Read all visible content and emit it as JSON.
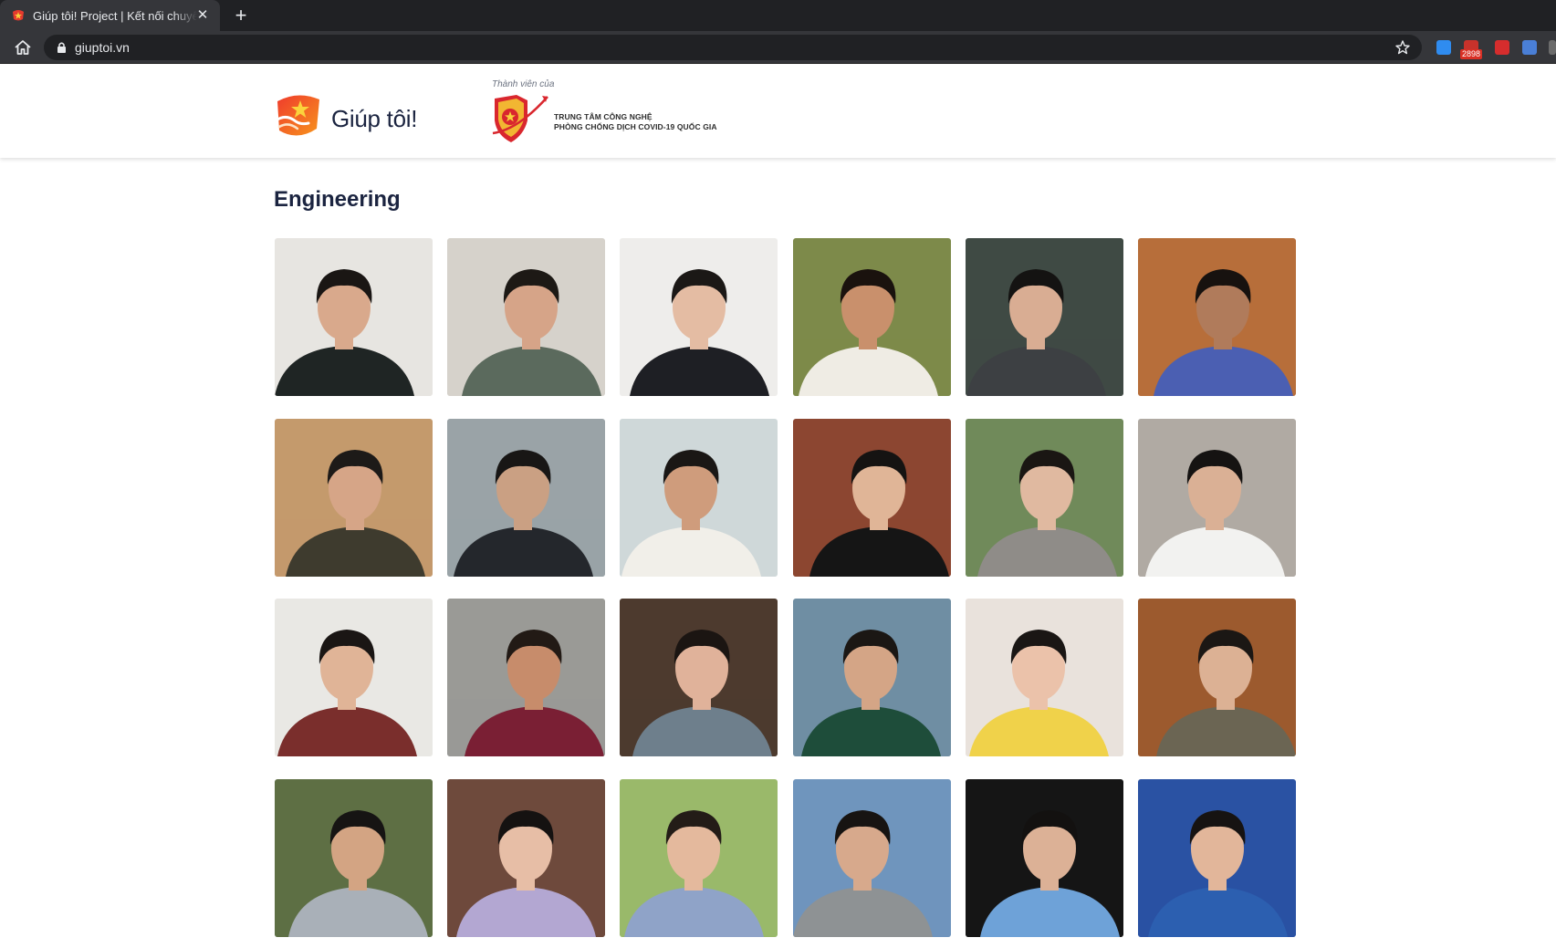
{
  "browser": {
    "tab_title": "Giúp tôi! Project | Kết nối chuyên gia",
    "url": "giuptoi.vn",
    "extension_badge": "2898"
  },
  "header": {
    "logo_text": "Giúp tôi!",
    "member_label": "Thành viên của",
    "partner_line1": "TRUNG TÂM CÔNG NGHỆ",
    "partner_line2": "PHÒNG CHỐNG DỊCH COVID-19 QUỐC GIA"
  },
  "section": {
    "title": "Engineering"
  },
  "team": [
    {
      "bg": "#e7e5e1",
      "shirt": "#1f2524",
      "skin": "#d9a98c",
      "hair": "#1a1614"
    },
    {
      "bg": "#d6d2cb",
      "shirt": "#5b6a5d",
      "skin": "#d6a488",
      "hair": "#1d1915"
    },
    {
      "bg": "#eeedeb",
      "shirt": "#1e1f24",
      "skin": "#e4bca3",
      "hair": "#1b1816"
    },
    {
      "bg": "#7d8a4a",
      "shirt": "#efece4",
      "skin": "#c9906c",
      "hair": "#1a120e"
    },
    {
      "bg": "#3f4a44",
      "shirt": "#3d4043",
      "skin": "#d9ad93",
      "hair": "#141312"
    },
    {
      "bg": "#b76e3a",
      "shirt": "#4b5fb2",
      "skin": "#b07b5b",
      "hair": "#17120f"
    },
    {
      "bg": "#c49a6c",
      "shirt": "#3e3b2e",
      "skin": "#d6a587",
      "hair": "#1d1a18"
    },
    {
      "bg": "#9aa3a7",
      "shirt": "#24272c",
      "skin": "#caa083",
      "hair": "#181615"
    },
    {
      "bg": "#cfd8d9",
      "shirt": "#f1efe9",
      "skin": "#cf9c7c",
      "hair": "#1a1715"
    },
    {
      "bg": "#8c4631",
      "shirt": "#151515",
      "skin": "#e0b597",
      "hair": "#151312"
    },
    {
      "bg": "#708a5a",
      "shirt": "#8f8c88",
      "skin": "#e0b9a0",
      "hair": "#1a1613"
    },
    {
      "bg": "#b0aaa3",
      "shirt": "#f2f2f0",
      "skin": "#dab095",
      "hair": "#151312"
    },
    {
      "bg": "#e9e8e4",
      "shirt": "#7a2e2c",
      "skin": "#e0b497",
      "hair": "#1a1614"
    },
    {
      "bg": "#9a9a96",
      "shirt": "#7a1f34",
      "skin": "#c78c6b",
      "hair": "#221a15"
    },
    {
      "bg": "#4d3a2e",
      "shirt": "#6e7f8c",
      "skin": "#e0b29a",
      "hair": "#1b1512"
    },
    {
      "bg": "#6f8ea3",
      "shirt": "#1e4d3a",
      "skin": "#d4a586",
      "hair": "#1b1714"
    },
    {
      "bg": "#e9e2dc",
      "shirt": "#f0d24a",
      "skin": "#ebc2aa",
      "hair": "#1a1614"
    },
    {
      "bg": "#9c5a2e",
      "shirt": "#6b6553",
      "skin": "#dcb194",
      "hair": "#1b1714"
    },
    {
      "bg": "#5e6f44",
      "shirt": "#a9b0b8",
      "skin": "#d3a483",
      "hair": "#161413"
    },
    {
      "bg": "#6e4a3c",
      "shirt": "#b3a7d2",
      "skin": "#e7bea6",
      "hair": "#151211"
    },
    {
      "bg": "#9ab96a",
      "shirt": "#8fa3c8",
      "skin": "#e4b99d",
      "hair": "#231c17"
    },
    {
      "bg": "#6f95bd",
      "shirt": "#8e9294",
      "skin": "#d7a98c",
      "hair": "#171412"
    },
    {
      "bg": "#151515",
      "shirt": "#6ea2d8",
      "skin": "#dcb196",
      "hair": "#131110"
    },
    {
      "bg": "#2a52a3",
      "shirt": "#2c5fb0",
      "skin": "#e2b69a",
      "hair": "#161312"
    }
  ]
}
